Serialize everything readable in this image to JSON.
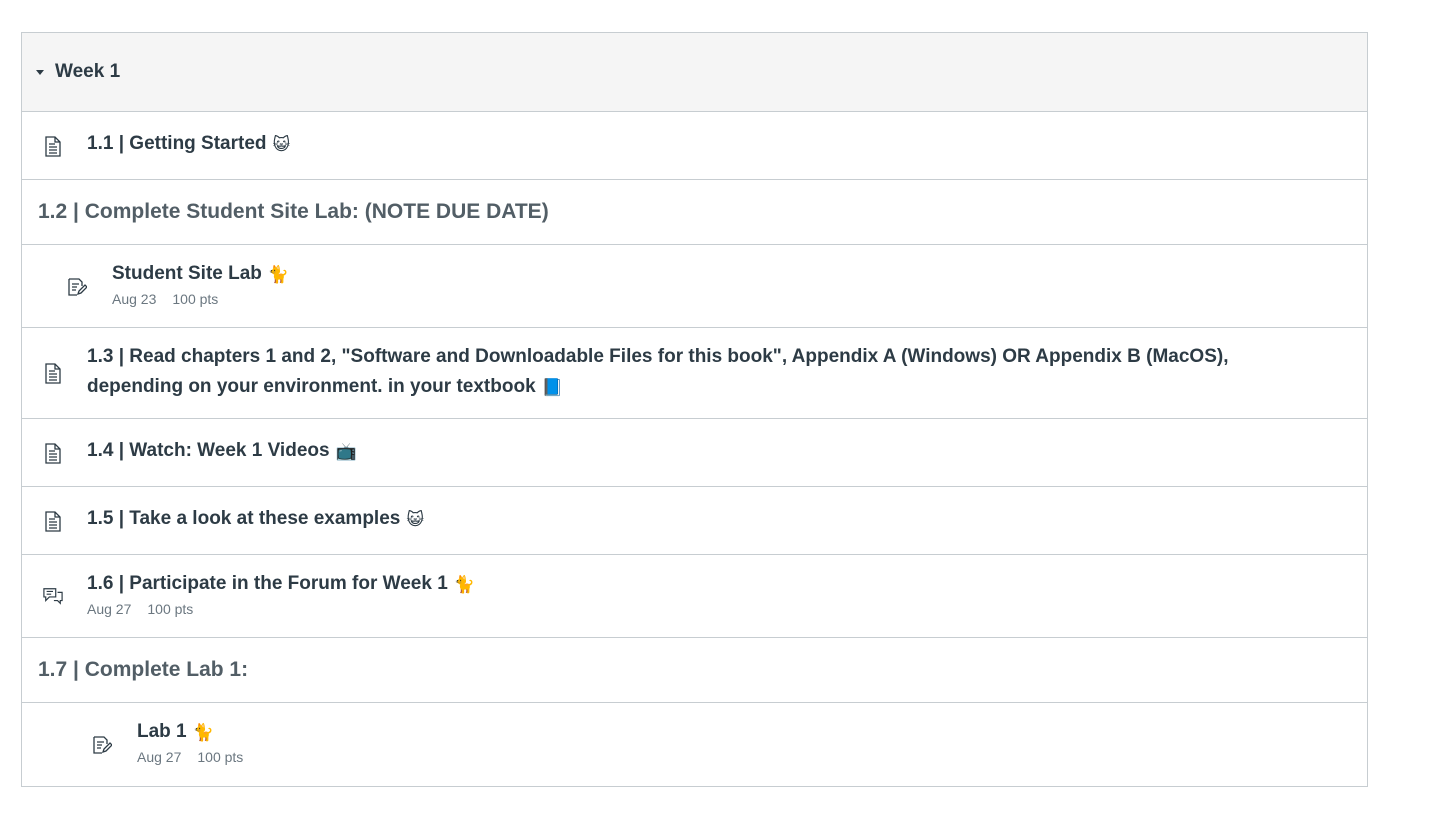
{
  "module": {
    "title": "Week 1",
    "caret_icon": "caret-down-icon"
  },
  "items": {
    "i1_1": {
      "title": "1.1 | Getting Started",
      "emoji": "😺",
      "icon": "page-icon"
    },
    "h1_2": {
      "title": "1.2 | Complete Student Site Lab: (NOTE DUE DATE)"
    },
    "a_student_site_lab": {
      "title": "Student Site Lab",
      "emoji": "🐈",
      "due": "Aug 23",
      "points": "100 pts",
      "icon": "assignment-icon"
    },
    "i1_3": {
      "title": "1.3 | Read chapters 1 and 2, \"Software and Downloadable Files for this book\", Appendix A (Windows) OR Appendix B (MacOS), depending on your environment. in your textbook",
      "emoji": "📘",
      "icon": "page-icon"
    },
    "i1_4": {
      "title": "1.4 | Watch: Week 1 Videos",
      "emoji": "📺",
      "icon": "page-icon"
    },
    "i1_5": {
      "title": "1.5 | Take a look at these examples",
      "emoji": "😺",
      "icon": "page-icon"
    },
    "i1_6": {
      "title": "1.6 | Participate in the Forum for Week 1",
      "emoji": "🐈",
      "due": "Aug 27",
      "points": "100 pts",
      "icon": "discussion-icon"
    },
    "h1_7": {
      "title": "1.7 | Complete Lab 1:"
    },
    "a_lab1": {
      "title": "Lab 1",
      "emoji": "🐈",
      "due": "Aug 27",
      "points": "100 pts",
      "icon": "assignment-icon"
    }
  },
  "colors": {
    "border": "#c7cdd1",
    "header_bg": "#f5f5f5",
    "text": "#2d3b45",
    "subheader_text": "#525e66",
    "meta_text": "#6b7780"
  }
}
